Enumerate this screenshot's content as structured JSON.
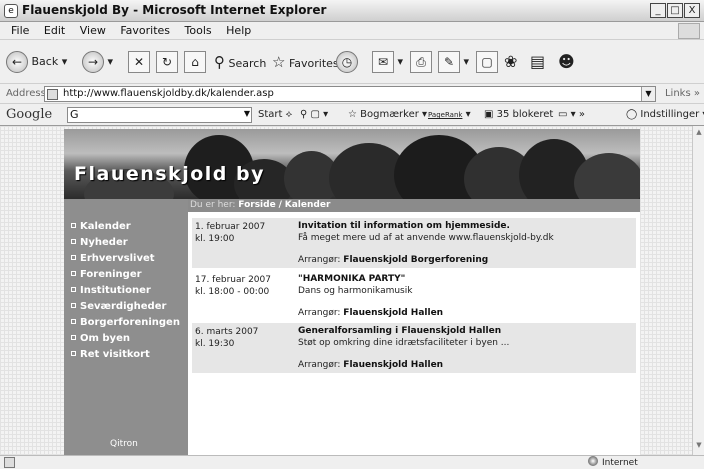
{
  "window": {
    "title": "Flauenskjold By - Microsoft Internet Explorer",
    "minimize": "_",
    "maximize": "□",
    "close": "X"
  },
  "menu": {
    "items": [
      "File",
      "Edit",
      "View",
      "Favorites",
      "Tools",
      "Help"
    ]
  },
  "toolbar": {
    "back_label": "Back",
    "search_label": "Search",
    "favorites_label": "Favorites"
  },
  "address": {
    "label": "Address",
    "url": "http://www.flauenskjoldby.dk/kalender.asp",
    "links_label": "Links",
    "links_more": "»"
  },
  "googlebar": {
    "logo": "Google",
    "search_prefix": "G",
    "start_label": "Start",
    "bookmarks_label": "Bogmærker",
    "pagerank_label": "PageRank",
    "blocked_label": "35 blokeret",
    "more_label": "»",
    "settings_label": "Indstillinger"
  },
  "site": {
    "title": "Flauenskjold by",
    "breadcrumb_prefix": "Du er her:",
    "breadcrumb_home": "Forside",
    "breadcrumb_sep": "/",
    "breadcrumb_current": "Kalender",
    "nav": [
      {
        "label": "Kalender"
      },
      {
        "label": "Nyheder"
      },
      {
        "label": "Erhvervslivet"
      },
      {
        "label": "Foreninger"
      },
      {
        "label": "Institutioner"
      },
      {
        "label": "Seværdigheder"
      },
      {
        "label": "Borgerforeningen"
      },
      {
        "label": "Om byen"
      },
      {
        "label": "Ret visitkort"
      }
    ],
    "sponsor": "Qitron",
    "organizer_label": "Arrangør:",
    "events": [
      {
        "date": "1. februar 2007",
        "time": "kl. 19:00",
        "title": "Invitation til information om hjemmeside.",
        "description": "Få meget mere ud af at anvende www.flauenskjold-by.dk",
        "organizer": "Flauenskjold Borgerforening"
      },
      {
        "date": "17. februar 2007",
        "time": "kl. 18:00 - 00:00",
        "title": "\"HARMONIKA PARTY\"",
        "description": "Dans og harmonikamusik",
        "organizer": "Flauenskjold Hallen"
      },
      {
        "date": "6. marts 2007",
        "time": "kl. 19:30",
        "title": "Generalforsamling i Flauenskjold Hallen",
        "description": "Støt op omkring dine idrætsfaciliteter i byen ...",
        "organizer": "Flauenskjold Hallen"
      }
    ]
  },
  "status": {
    "zone": "Internet"
  }
}
